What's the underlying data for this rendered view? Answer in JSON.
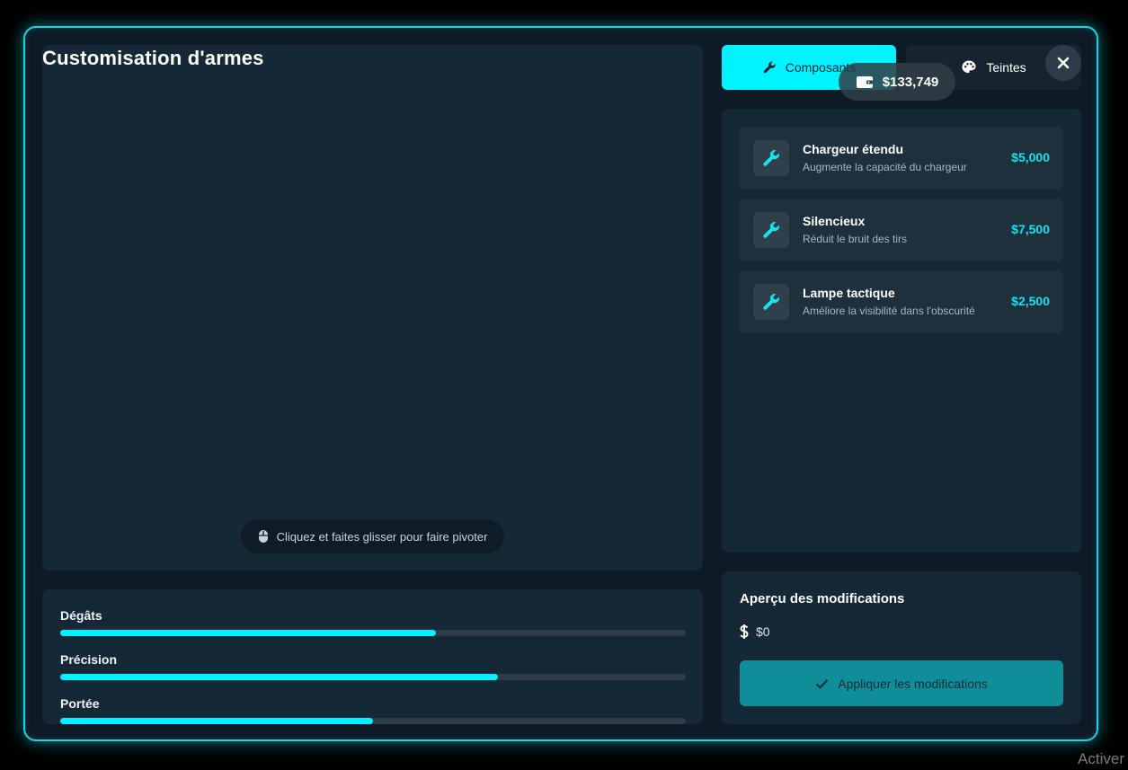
{
  "header": {
    "title": "Customisation d'armes"
  },
  "viewer": {
    "rotate_hint": "Cliquez et faites glisser pour faire pivoter",
    "hint_icon": "mouse-icon"
  },
  "stats": [
    {
      "label": "Dégâts",
      "value": 0.6
    },
    {
      "label": "Précision",
      "value": 0.7
    },
    {
      "label": "Portée",
      "value": 0.5
    }
  ],
  "tabs": [
    {
      "label": "Composants",
      "icon": "wrench-icon",
      "active": true
    },
    {
      "label": "Teintes",
      "icon": "palette-icon",
      "active": false
    }
  ],
  "balance": {
    "amount": "$133,749",
    "icon": "wallet-icon"
  },
  "components": [
    {
      "name": "Chargeur étendu",
      "description": "Augmente la capacité du chargeur",
      "price": "$5,000"
    },
    {
      "name": "Silencieux",
      "description": "Réduit le bruit des tirs",
      "price": "$7,500"
    },
    {
      "name": "Lampe tactique",
      "description": "Améliore la visibilité dans l'obscurité",
      "price": "$2,500"
    }
  ],
  "summary": {
    "title": "Aperçu des modifications",
    "total": "$0",
    "apply_label": "Appliquer les modifications"
  },
  "colors": {
    "accent": "#00f1ff",
    "panel": "#152836",
    "background": "#0e1b26"
  },
  "watermark": "Activer"
}
